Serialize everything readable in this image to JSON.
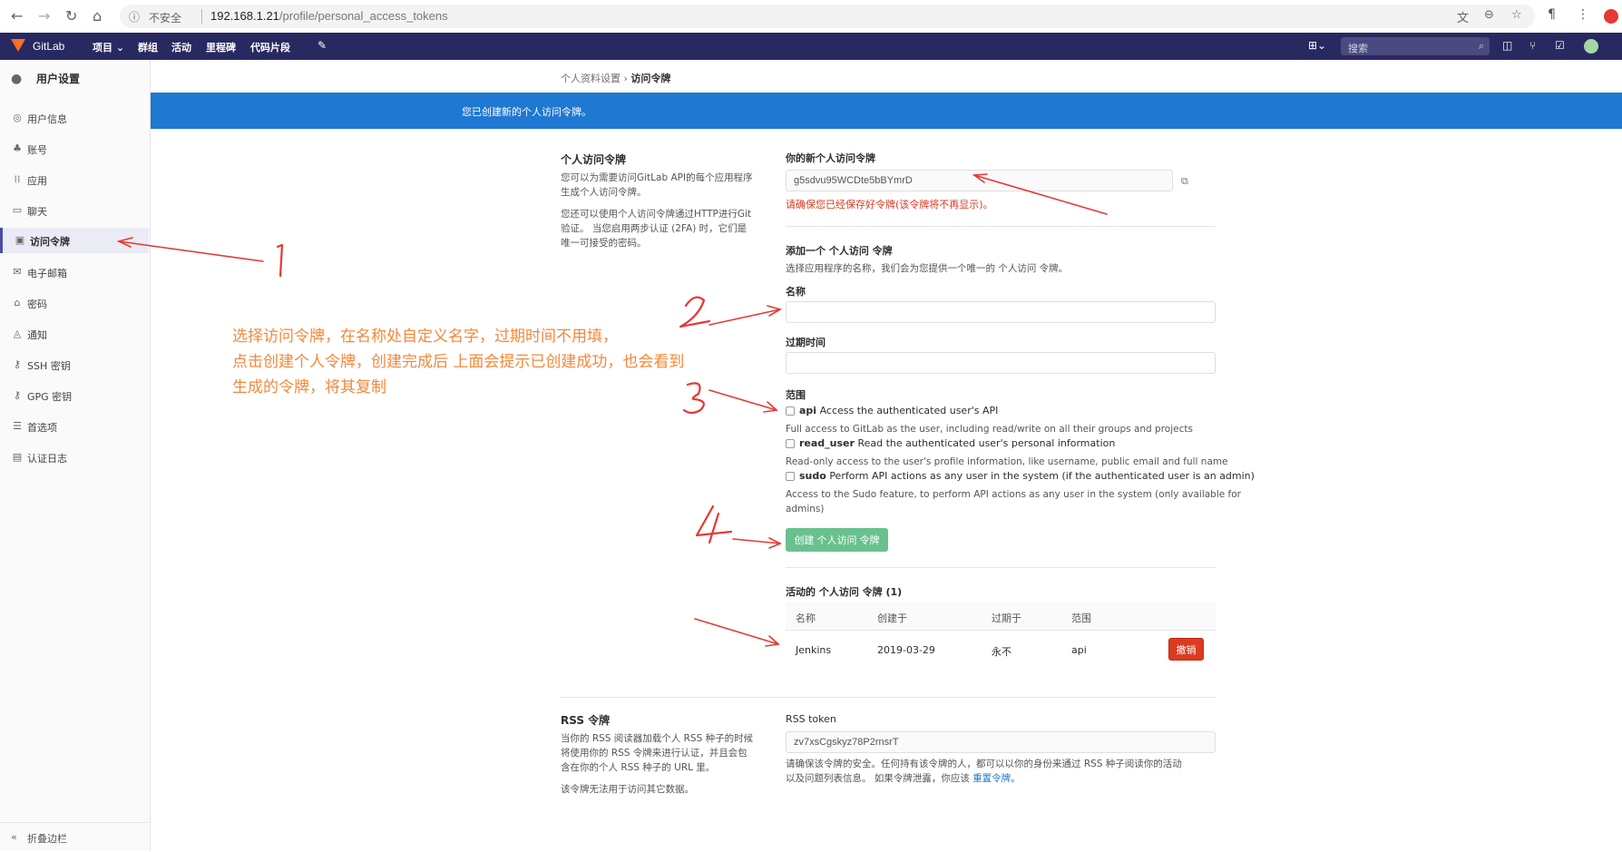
{
  "browser": {
    "security_label": "不安全",
    "url_host": "192.168.1.21",
    "url_path": "/profile/personal_access_tokens"
  },
  "header": {
    "brand": "GitLab",
    "nav": [
      {
        "label": "项目",
        "caret": "⌄"
      },
      {
        "label": "群组"
      },
      {
        "label": "活动"
      },
      {
        "label": "里程碑"
      },
      {
        "label": "代码片段"
      }
    ],
    "search_placeholder": "搜索",
    "icons": [
      "wrench-icon",
      "plus-icon",
      "search-icon",
      "sidebar-icon",
      "merge-request-icon",
      "todo-icon",
      "avatar"
    ]
  },
  "sidebar": {
    "title": "用户设置",
    "items": [
      {
        "label": "用户信息",
        "icon": "profile-icon"
      },
      {
        "label": "账号",
        "icon": "account-icon"
      },
      {
        "label": "应用",
        "icon": "applications-icon"
      },
      {
        "label": "聊天",
        "icon": "chat-icon"
      },
      {
        "label": "访问令牌",
        "icon": "token-icon",
        "active": true
      },
      {
        "label": "电子邮箱",
        "icon": "email-icon"
      },
      {
        "label": "密码",
        "icon": "lock-icon"
      },
      {
        "label": "通知",
        "icon": "bell-icon"
      },
      {
        "label": "SSH 密钥",
        "icon": "key-icon"
      },
      {
        "label": "GPG 密钥",
        "icon": "key-icon"
      },
      {
        "label": "首选项",
        "icon": "preferences-icon"
      },
      {
        "label": "认证日志",
        "icon": "log-icon"
      }
    ],
    "collapse_label": "折叠边栏"
  },
  "breadcrumb": {
    "parent": "个人资料设置",
    "separator": "›",
    "current": "访问令牌"
  },
  "flash": "您已创建新的个人访问令牌。",
  "pat_section": {
    "title": "个人访问令牌",
    "desc1_l1": "您可以为需要访问GitLab API的每个应用程序",
    "desc1_l2": "生成个人访问令牌。",
    "desc2_l1": "您还可以使用个人访问令牌通过HTTP进行Git",
    "desc2_l2": "验证。 当您启用两步认证 (2FA) 时，它们是",
    "desc2_l3": "唯一可接受的密码。"
  },
  "new_token": {
    "label": "你的新个人访问令牌",
    "value": "g5sdvu95WCDte5bBYmrD",
    "warning": "请确保您已经保存好令牌(该令牌将不再显示)。"
  },
  "add_form": {
    "title": "添加一个 个人访问 令牌",
    "desc": "选择应用程序的名称，我们会为您提供一个唯一的 个人访问 令牌。",
    "name_label": "名称",
    "name_value": "",
    "expires_label": "过期时间",
    "expires_value": "",
    "scopes_label": "范围",
    "scopes": [
      {
        "name": "api",
        "desc": "Access the authenticated user's API",
        "help": "Full access to GitLab as the user, including read/write on all their groups and projects",
        "checked": false
      },
      {
        "name": "read_user",
        "desc": "Read the authenticated user's personal information",
        "help": "Read-only access to the user's profile information, like username, public email and full name",
        "checked": false
      },
      {
        "name": "sudo",
        "desc": "Perform API actions as any user in the system (if the authenticated user is an admin)",
        "help_l1": "Access to the Sudo feature, to perform API actions as any user in the system (only available for",
        "help_l2": "admins)",
        "checked": false
      }
    ],
    "submit_label": "创建 个人访问 令牌"
  },
  "active_tokens": {
    "title": "活动的 个人访问 令牌 (1)",
    "columns": [
      "名称",
      "创建于",
      "过期于",
      "范围"
    ],
    "rows": [
      {
        "name": "Jenkins",
        "created": "2019-03-29",
        "expires": "永不",
        "scopes": "api",
        "action": "撤销"
      }
    ]
  },
  "rss_section": {
    "title": "RSS 令牌",
    "desc_l1": "当你的 RSS 阅读器加载个人 RSS 种子的时候",
    "desc_l2": "将使用你的 RSS 令牌来进行认证，并且会包",
    "desc_l3": "含在你的个人 RSS 种子的 URL 里。",
    "desc_l4": "该令牌无法用于访问其它数据。",
    "token_label": "RSS token",
    "token_value": "zv7xsCgskyz78P2rnsrT",
    "help_l1": "请确保该令牌的安全。任何持有该令牌的人，都可以以你的身份来通过 RSS 种子阅读你的活动",
    "help_l2_prefix": "以及问题列表信息。 如果令牌泄露，你应该 ",
    "help_link": "重置令牌",
    "help_l2_suffix": "。"
  },
  "annotation": {
    "line1": "选择访问令牌，在名称处自定义名字，过期时间不用填，",
    "line2": "点击创建个人令牌，创建完成后 上面会提示已创建成功，也会看到",
    "line3": "生成的令牌，将其复制",
    "color": "#f4883a",
    "arrow_color": "#e53935"
  }
}
